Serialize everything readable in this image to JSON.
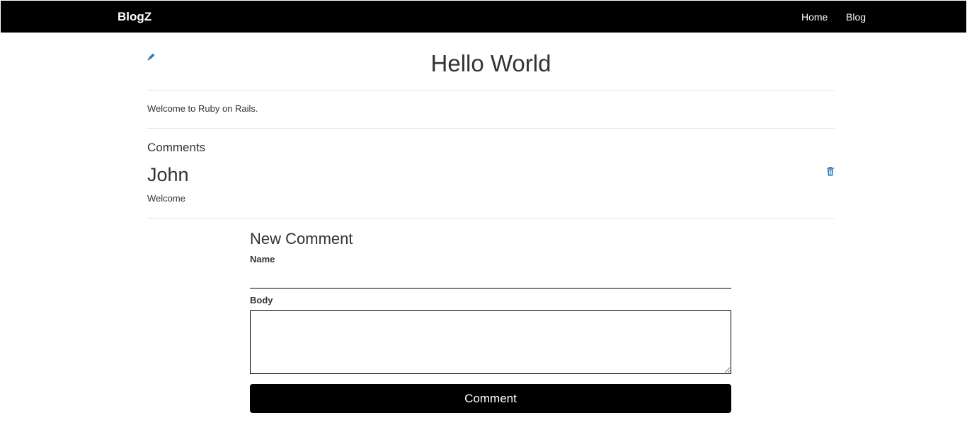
{
  "navbar": {
    "brand": "BlogZ",
    "links": [
      {
        "label": "Home"
      },
      {
        "label": "Blog"
      }
    ],
    "background": "#000000"
  },
  "post": {
    "title": "Hello World",
    "body": "Welcome to Ruby on Rails.",
    "edit_icon": "pencil-icon"
  },
  "comments": {
    "heading": "Comments",
    "items": [
      {
        "author": "John",
        "body": "Welcome",
        "delete_icon": "trash-icon"
      }
    ]
  },
  "new_comment": {
    "heading": "New Comment",
    "name_label": "Name",
    "name_value": "",
    "body_label": "Body",
    "body_value": "",
    "submit_label": "Comment"
  },
  "colors": {
    "icon_accent": "#337ab7",
    "button": "#000000",
    "text": "#333333"
  }
}
